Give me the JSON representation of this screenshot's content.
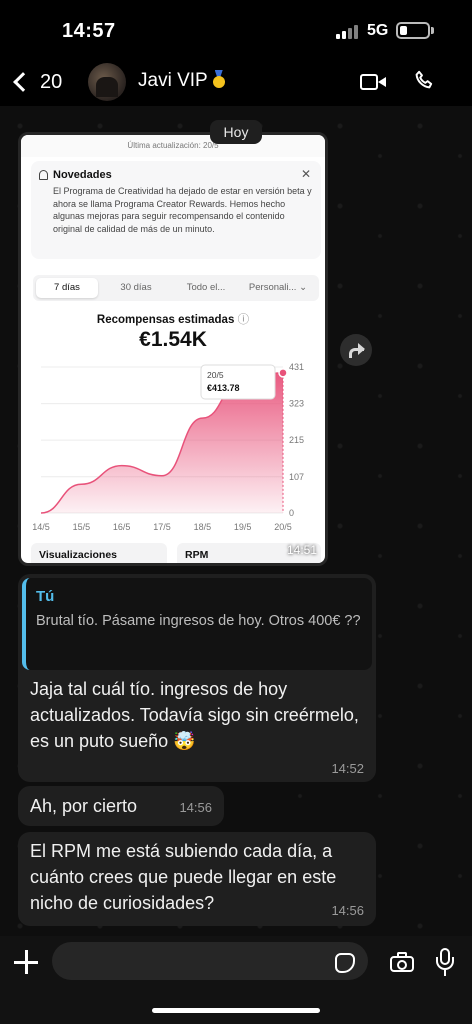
{
  "status": {
    "time": "14:57",
    "network": "5G",
    "battery_level": 0.2
  },
  "header": {
    "back_count": "20",
    "contact_name": "Javi VIP",
    "avatar_icon": "group-photo",
    "medal_icon": "medal-icon"
  },
  "date_chip": "Hoy",
  "screenshot": {
    "updated": "Última actualización: 20/5",
    "notice_title": "Novedades",
    "notice_text": "El Programa de Creatividad ha dejado de estar en versión beta y ahora se llama Programa Creator Rewards. Hemos hecho algunas mejoras para seguir recompensando el contenido original de calidad de más de un minuto.",
    "tabs": [
      "7 días",
      "30 días",
      "Todo el...",
      "Personali..."
    ],
    "rewards_title": "Recompensas estimadas",
    "rewards_value": "€1.54K",
    "stat_labels": [
      "Visualizaciones",
      "RPM"
    ],
    "time": "14:51"
  },
  "chart_data": {
    "type": "area",
    "x": [
      "14/5",
      "15/5",
      "16/5",
      "17/5",
      "18/5",
      "19/5",
      "20/5"
    ],
    "values": [
      0,
      85,
      140,
      110,
      280,
      395,
      413.78
    ],
    "yticks": [
      0,
      107,
      215,
      323,
      431
    ],
    "ylim": [
      0,
      431
    ],
    "tooltip": {
      "date": "20/5",
      "value": "€413.78"
    },
    "color": "#e8527a"
  },
  "messages": [
    {
      "quote_author": "Tú",
      "quote_text": "Brutal tío. Pásame ingresos de hoy. Otros 400€ ??",
      "text": "Jaja tal cuál tío. ingresos de hoy actualizados. Todavía sigo sin creérmelo, es un puto sueño 🤯",
      "time": "14:52"
    },
    {
      "text": "Ah, por cierto",
      "time": "14:56"
    },
    {
      "text": "El RPM me está subiendo cada día, a cuánto crees que puede llegar en este nicho de curiosidades?",
      "time": "14:56"
    }
  ]
}
